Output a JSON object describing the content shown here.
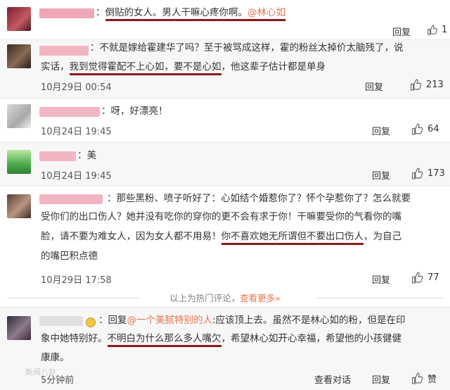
{
  "comments": [
    {
      "text_a": "：",
      "text_b_underline": "倒贴的女人。男人干嘛心疼你啊。",
      "mention": "@林心如",
      "reply": "回复",
      "likes": "1"
    },
    {
      "text_a": "：不就是嫁给霍建华了吗？至于被骂成这样，霍的粉丝太掉价太脑残了，说",
      "text_b": "实话，",
      "text_b_underline": "我到觉得霍配不上心如，要不是心如",
      "text_c": "，他这辈子估计都是单身",
      "time": "10月29日 00:54",
      "reply": "回复",
      "likes": "213"
    },
    {
      "text_a": "：呀，好漂亮！",
      "time": "10月24日 19:45",
      "reply": "回复",
      "likes": "64"
    },
    {
      "text_a": "：美",
      "time": "10月24日 19:45",
      "reply": "回复",
      "likes": "173"
    },
    {
      "text_a": "：那些黑粉、喷子听好了：心如结个婚惹你了？怀个孕惹你了？怎么就要",
      "text_b": "受你们的出口伤人？她并没有吃你的穿你的更不会有求于你！干嘛要受你的气看你的嘴",
      "text_c": "脸，请不要为难女人，因为女人都不用易！",
      "text_c_underline": "你不喜欢她无所谓但不要出口伤人",
      "text_c_end": "，为自己",
      "text_d": "的嘴巴积点德",
      "time": "10月29日 17:58",
      "reply": "回复",
      "likes": "77"
    }
  ],
  "hot_notice": "以上为热门评论，",
  "hot_more": "查看更多»",
  "latest": {
    "prefix": "：回复",
    "mention": "@一个美腻特别的人",
    "text_a": ":应该顶上去。虽然不是林心如的粉，但是在印",
    "text_b": "象中她特别好。",
    "text_b_underline": "不明白为什么那么多人嘴欠",
    "text_b_end": "，希望林心如开心幸福，希望他的小孩健健",
    "text_c": "康康。",
    "time": "5分钟前",
    "view_dialog": "查看对话",
    "reply": "回复",
    "likes": "赞"
  },
  "watermark": "新闻八卦"
}
